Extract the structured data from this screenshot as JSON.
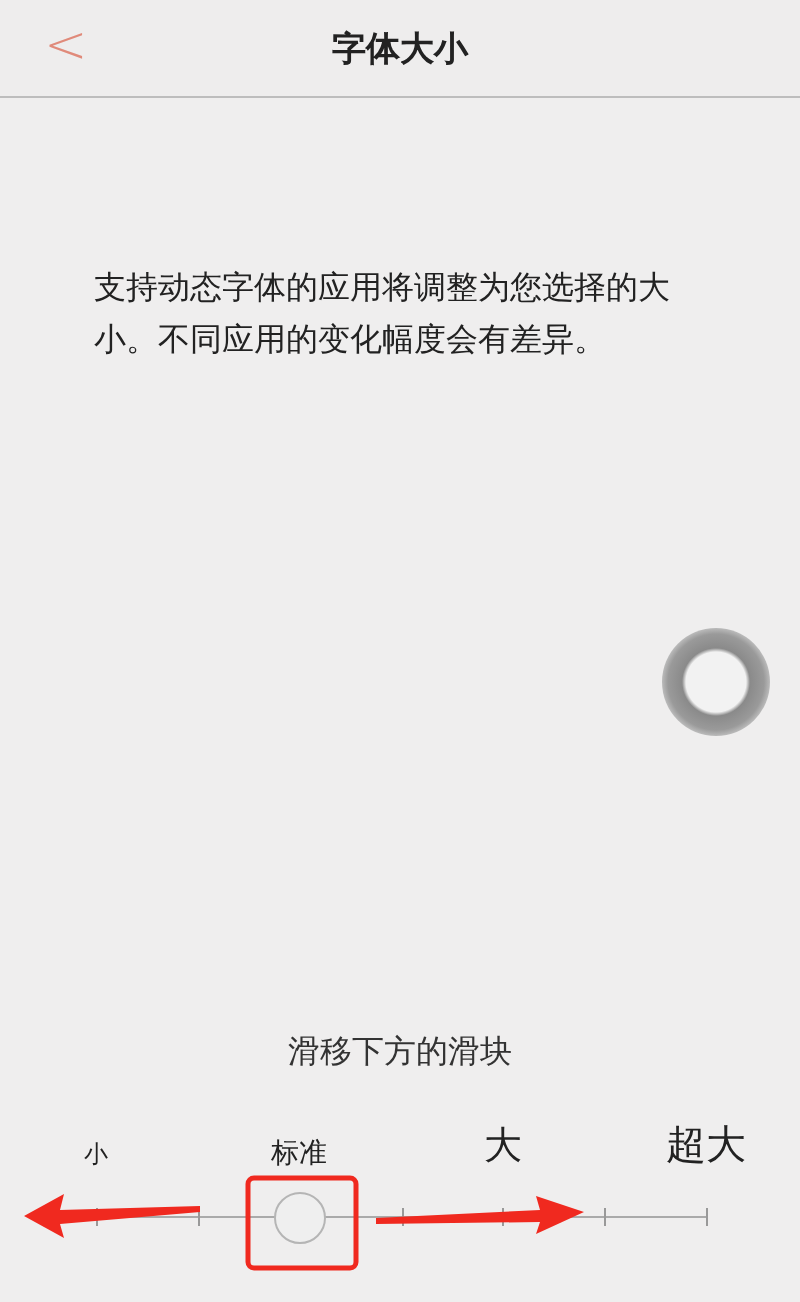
{
  "nav_bar": {
    "back": "<",
    "title": "字体大小"
  },
  "description": "支持动态字体的应用将调整为您选择的大小。不同应用的变化幅度会有差异。",
  "hint": "滑移下方的滑块",
  "slider": {
    "labels": [
      "小",
      "标准",
      "大",
      "超大"
    ],
    "level": 0.333
  }
}
